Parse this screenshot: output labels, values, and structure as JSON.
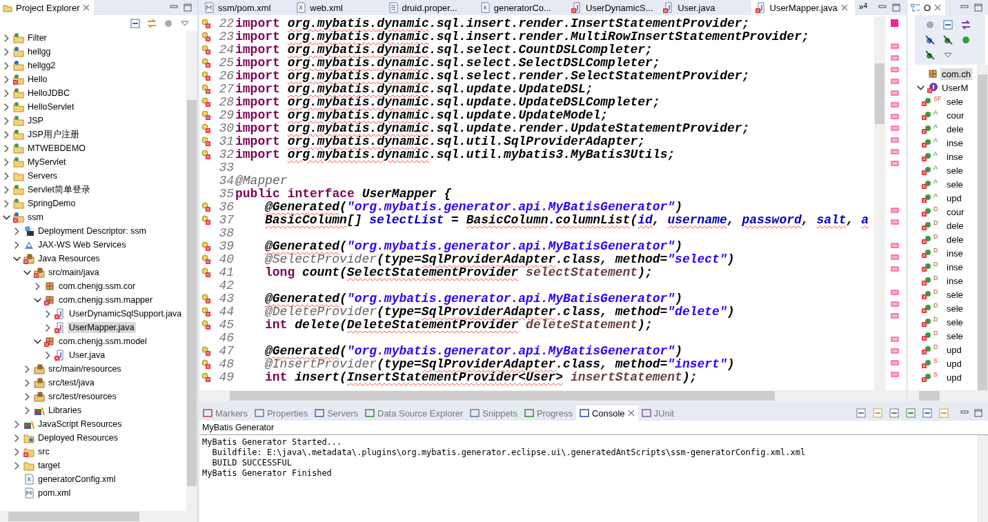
{
  "project_explorer": {
    "title": "Project Explorer",
    "tree": [
      {
        "label": "Filter",
        "kind": "project",
        "expanded": false,
        "selected": false,
        "error": false
      },
      {
        "label": "hellgg",
        "kind": "maven",
        "expanded": false,
        "selected": false,
        "error": false
      },
      {
        "label": "hellgg2",
        "kind": "maven",
        "expanded": false,
        "selected": false,
        "error": false
      },
      {
        "label": "Hello",
        "kind": "project",
        "expanded": false,
        "selected": false,
        "error": true
      },
      {
        "label": "HelloJDBC",
        "kind": "project",
        "expanded": false,
        "selected": false,
        "error": false
      },
      {
        "label": "HelloServlet",
        "kind": "project",
        "expanded": false,
        "selected": false,
        "error": false
      },
      {
        "label": "JSP",
        "kind": "project",
        "expanded": false,
        "selected": false,
        "error": false
      },
      {
        "label": "JSP用户注册",
        "kind": "project",
        "expanded": false,
        "selected": false,
        "error": false
      },
      {
        "label": "MTWEBDEMO",
        "kind": "project",
        "expanded": false,
        "selected": false,
        "error": false
      },
      {
        "label": "MyServlet",
        "kind": "project",
        "expanded": false,
        "selected": false,
        "error": false
      },
      {
        "label": "Servers",
        "kind": "folder",
        "expanded": false,
        "selected": false,
        "error": false
      },
      {
        "label": "Servlet简单登录",
        "kind": "project",
        "expanded": false,
        "selected": false,
        "error": false
      },
      {
        "label": "SpringDemo",
        "kind": "project",
        "expanded": false,
        "selected": false,
        "error": false
      },
      {
        "label": "ssm",
        "kind": "maven",
        "expanded": true,
        "selected": false,
        "error": true,
        "children": [
          {
            "label": "Deployment Descriptor: ssm",
            "kind": "descriptor",
            "expanded": false,
            "selected": false,
            "error": false
          },
          {
            "label": "JAX-WS Web Services",
            "kind": "webservice",
            "expanded": false,
            "selected": false,
            "error": false
          },
          {
            "label": "Java Resources",
            "kind": "resources",
            "expanded": true,
            "selected": false,
            "error": true,
            "children": [
              {
                "label": "src/main/java",
                "kind": "source",
                "expanded": true,
                "selected": false,
                "error": true,
                "children": [
                  {
                    "label": "com.chenjg.ssm.cor",
                    "kind": "package",
                    "expanded": false,
                    "selected": false,
                    "error": false
                  },
                  {
                    "label": "com.chenjg.ssm.mapper",
                    "kind": "package",
                    "expanded": true,
                    "selected": false,
                    "error": true,
                    "children": [
                      {
                        "label": "UserDynamicSqlSupport.java",
                        "kind": "java",
                        "expanded": false,
                        "selected": false,
                        "error": true
                      },
                      {
                        "label": "UserMapper.java",
                        "kind": "interface",
                        "expanded": false,
                        "selected": true,
                        "error": true
                      }
                    ]
                  },
                  {
                    "label": "com.chenjg.ssm.model",
                    "kind": "package",
                    "expanded": true,
                    "selected": false,
                    "error": true,
                    "children": [
                      {
                        "label": "User.java",
                        "kind": "java",
                        "expanded": false,
                        "selected": false,
                        "error": true
                      }
                    ]
                  }
                ]
              },
              {
                "label": "src/main/resources",
                "kind": "source",
                "expanded": false,
                "selected": false,
                "error": false
              },
              {
                "label": "src/test/java",
                "kind": "source",
                "expanded": false,
                "selected": false,
                "error": false
              },
              {
                "label": "src/test/resources",
                "kind": "source",
                "expanded": false,
                "selected": false,
                "error": false
              },
              {
                "label": "Libraries",
                "kind": "library",
                "expanded": false,
                "selected": false,
                "error": false
              }
            ]
          },
          {
            "label": "JavaScript Resources",
            "kind": "library",
            "expanded": false,
            "selected": false,
            "error": false
          },
          {
            "label": "Deployed Resources",
            "kind": "deployed",
            "expanded": false,
            "selected": false,
            "error": false
          },
          {
            "label": "src",
            "kind": "folder",
            "expanded": false,
            "selected": false,
            "error": true
          },
          {
            "label": "target",
            "kind": "folder",
            "expanded": false,
            "selected": false,
            "error": false
          },
          {
            "label": "generatorConfig.xml",
            "kind": "xml",
            "expanded": false,
            "selected": false,
            "error": false
          },
          {
            "label": "pom.xml",
            "kind": "pom",
            "expanded": false,
            "selected": false,
            "error": false
          }
        ]
      }
    ]
  },
  "editor": {
    "tabs": [
      {
        "label": "ssm/pom.xml",
        "kind": "pom",
        "selected": false,
        "error": false
      },
      {
        "label": "web.xml",
        "kind": "xml",
        "selected": false,
        "error": false
      },
      {
        "label": "druid.proper...",
        "kind": "text",
        "selected": false,
        "error": false
      },
      {
        "label": "generatorCo...",
        "kind": "xml",
        "selected": false,
        "error": false
      },
      {
        "label": "UserDynamicS...",
        "kind": "java",
        "selected": false,
        "error": true
      },
      {
        "label": "User.java",
        "kind": "java",
        "selected": false,
        "error": true
      },
      {
        "label": "UserMapper.java",
        "kind": "java",
        "selected": true,
        "error": true
      }
    ],
    "overflow": {
      "symbol": "»",
      "count": "4"
    },
    "lines": [
      {
        "number": "22",
        "marker": true,
        "indented": false,
        "segments": [
          {
            "t": "import ",
            "kind": "kw"
          },
          {
            "t": "org.mybatis.dynamic",
            "kind": "err"
          },
          {
            "t": ".sql.insert.render.InsertStatementProvider;",
            "kind": "bi"
          }
        ]
      },
      {
        "number": "23",
        "marker": true,
        "indented": false,
        "segments": [
          {
            "t": "import ",
            "kind": "kw"
          },
          {
            "t": "org.mybatis.dynamic",
            "kind": "err"
          },
          {
            "t": ".sql.insert.render.MultiRowInsertStatementProvider;",
            "kind": "bi"
          }
        ]
      },
      {
        "number": "24",
        "marker": true,
        "indented": false,
        "segments": [
          {
            "t": "import ",
            "kind": "kw"
          },
          {
            "t": "org.mybatis.dynamic",
            "kind": "err"
          },
          {
            "t": ".sql.select.CountDSLCompleter;",
            "kind": "bi"
          }
        ]
      },
      {
        "number": "25",
        "marker": true,
        "indented": false,
        "segments": [
          {
            "t": "import ",
            "kind": "kw"
          },
          {
            "t": "org.mybatis.dynamic",
            "kind": "err"
          },
          {
            "t": ".sql.select.SelectDSLCompleter;",
            "kind": "bi"
          }
        ]
      },
      {
        "number": "26",
        "marker": true,
        "indented": false,
        "segments": [
          {
            "t": "import ",
            "kind": "kw"
          },
          {
            "t": "org.mybatis.dynamic",
            "kind": "err"
          },
          {
            "t": ".sql.select.render.SelectStatementProvider;",
            "kind": "bi"
          }
        ]
      },
      {
        "number": "27",
        "marker": true,
        "indented": false,
        "segments": [
          {
            "t": "import ",
            "kind": "kw"
          },
          {
            "t": "org.mybatis.dynamic",
            "kind": "err"
          },
          {
            "t": ".sql.update.UpdateDSL;",
            "kind": "bi"
          }
        ]
      },
      {
        "number": "28",
        "marker": true,
        "indented": false,
        "segments": [
          {
            "t": "import ",
            "kind": "kw"
          },
          {
            "t": "org.mybatis.dynamic",
            "kind": "err"
          },
          {
            "t": ".sql.update.UpdateDSLCompleter;",
            "kind": "bi"
          }
        ]
      },
      {
        "number": "29",
        "marker": true,
        "indented": false,
        "segments": [
          {
            "t": "import ",
            "kind": "kw"
          },
          {
            "t": "org.mybatis.dynamic",
            "kind": "err"
          },
          {
            "t": ".sql.update.UpdateModel;",
            "kind": "bi"
          }
        ]
      },
      {
        "number": "30",
        "marker": true,
        "indented": false,
        "segments": [
          {
            "t": "import ",
            "kind": "kw"
          },
          {
            "t": "org.mybatis.dynamic",
            "kind": "err"
          },
          {
            "t": ".sql.update.render.UpdateStatementProvider;",
            "kind": "bi"
          }
        ]
      },
      {
        "number": "31",
        "marker": true,
        "indented": false,
        "segments": [
          {
            "t": "import ",
            "kind": "kw"
          },
          {
            "t": "org.mybatis.dynamic",
            "kind": "err"
          },
          {
            "t": ".sql.util.SqlProviderAdapter;",
            "kind": "bi"
          }
        ]
      },
      {
        "number": "32",
        "marker": true,
        "indented": false,
        "segments": [
          {
            "t": "import ",
            "kind": "kw"
          },
          {
            "t": "org.mybatis.dynamic",
            "kind": "err"
          },
          {
            "t": ".sql.util.mybatis3.MyBatis3Utils;",
            "kind": "bi"
          }
        ]
      },
      {
        "number": "33",
        "marker": false,
        "indented": false
      },
      {
        "number": "34",
        "marker": false,
        "indented": false,
        "segments": [
          {
            "t": "@Mapper",
            "kind": "ann"
          }
        ]
      },
      {
        "number": "35",
        "marker": false,
        "indented": false,
        "segments": [
          {
            "t": "public interface",
            "kind": "kw"
          },
          {
            "t": " UserMapper {",
            "kind": "bi"
          }
        ]
      },
      {
        "number": "36",
        "marker": true,
        "indented": true,
        "segments": [
          {
            "t": "@Generated",
            "kind": "err"
          },
          {
            "t": "(",
            "kind": "bi"
          },
          {
            "t": "\"org.mybatis.generator.api.MyBatisGenerator\"",
            "kind": "str"
          },
          {
            "t": ")",
            "kind": "bi"
          }
        ]
      },
      {
        "number": "37",
        "marker": true,
        "indented": true,
        "segments": [
          {
            "t": "BasicColumn",
            "kind": "err"
          },
          {
            "t": "[] ",
            "kind": "bi"
          },
          {
            "t": "selectList",
            "kind": "fld"
          },
          {
            "t": " = ",
            "kind": "bi"
          },
          {
            "t": "BasicColumn",
            "kind": "err"
          },
          {
            "t": ".",
            "kind": "bi"
          },
          {
            "t": "columnList",
            "kind": "err"
          },
          {
            "t": "(",
            "kind": "bi"
          },
          {
            "t": "id",
            "kind": "ferr"
          },
          {
            "t": ", ",
            "kind": "bi"
          },
          {
            "t": "username",
            "kind": "ferr"
          },
          {
            "t": ", ",
            "kind": "bi"
          },
          {
            "t": "password",
            "kind": "ferr"
          },
          {
            "t": ", ",
            "kind": "bi"
          },
          {
            "t": "salt",
            "kind": "ferr"
          },
          {
            "t": ", ",
            "kind": "bi"
          },
          {
            "t": "a",
            "kind": "ferr"
          }
        ]
      },
      {
        "number": "38",
        "marker": false,
        "indented": false
      },
      {
        "number": "39",
        "marker": true,
        "indented": true,
        "segments": [
          {
            "t": "@Generated",
            "kind": "err"
          },
          {
            "t": "(",
            "kind": "bi"
          },
          {
            "t": "\"org.mybatis.generator.api.MyBatisGenerator\"",
            "kind": "str"
          },
          {
            "t": ")",
            "kind": "bi"
          }
        ]
      },
      {
        "number": "40",
        "marker": true,
        "indented": true,
        "segments": [
          {
            "t": "@SelectProvider",
            "kind": "ann"
          },
          {
            "t": "(type=",
            "kind": "bi"
          },
          {
            "t": "SqlProviderAdapter",
            "kind": "err"
          },
          {
            "t": ".class, method=",
            "kind": "bi"
          },
          {
            "t": "\"select\"",
            "kind": "str"
          },
          {
            "t": ")",
            "kind": "bi"
          }
        ]
      },
      {
        "number": "41",
        "marker": true,
        "indented": true,
        "segments": [
          {
            "t": "long",
            "kind": "kw"
          },
          {
            "t": " count(",
            "kind": "bi"
          },
          {
            "t": "SelectStatementProvider",
            "kind": "err"
          },
          {
            "t": " selectStatement",
            "kind": "prm"
          },
          {
            "t": ");",
            "kind": "bi"
          }
        ]
      },
      {
        "number": "42",
        "marker": false,
        "indented": false
      },
      {
        "number": "43",
        "marker": true,
        "indented": true,
        "segments": [
          {
            "t": "@Generated",
            "kind": "err"
          },
          {
            "t": "(",
            "kind": "bi"
          },
          {
            "t": "\"org.mybatis.generator.api.MyBatisGenerator\"",
            "kind": "str"
          },
          {
            "t": ")",
            "kind": "bi"
          }
        ]
      },
      {
        "number": "44",
        "marker": true,
        "indented": true,
        "segments": [
          {
            "t": "@DeleteProvider",
            "kind": "ann"
          },
          {
            "t": "(type=",
            "kind": "bi"
          },
          {
            "t": "SqlProviderAdapter",
            "kind": "err"
          },
          {
            "t": ".class, method=",
            "kind": "bi"
          },
          {
            "t": "\"delete\"",
            "kind": "str"
          },
          {
            "t": ")",
            "kind": "bi"
          }
        ]
      },
      {
        "number": "45",
        "marker": true,
        "indented": true,
        "segments": [
          {
            "t": "int",
            "kind": "kw"
          },
          {
            "t": " delete(",
            "kind": "bi"
          },
          {
            "t": "DeleteStatementProvider",
            "kind": "err"
          },
          {
            "t": " deleteStatement",
            "kind": "prm"
          },
          {
            "t": ");",
            "kind": "bi"
          }
        ]
      },
      {
        "number": "46",
        "marker": false,
        "indented": false
      },
      {
        "number": "47",
        "marker": true,
        "indented": true,
        "segments": [
          {
            "t": "@Generated",
            "kind": "err"
          },
          {
            "t": "(",
            "kind": "bi"
          },
          {
            "t": "\"org.mybatis.generator.api.MyBatisGenerator\"",
            "kind": "str"
          },
          {
            "t": ")",
            "kind": "bi"
          }
        ]
      },
      {
        "number": "48",
        "marker": true,
        "indented": true,
        "segments": [
          {
            "t": "@InsertProvider",
            "kind": "ann"
          },
          {
            "t": "(type=",
            "kind": "bi"
          },
          {
            "t": "SqlProviderAdapter",
            "kind": "err"
          },
          {
            "t": ".class, method=",
            "kind": "bi"
          },
          {
            "t": "\"insert\"",
            "kind": "str"
          },
          {
            "t": ")",
            "kind": "bi"
          }
        ]
      },
      {
        "number": "49",
        "marker": true,
        "indented": true,
        "segments": [
          {
            "t": "int",
            "kind": "kw"
          },
          {
            "t": " insert(",
            "kind": "bi"
          },
          {
            "t": "InsertStatementProvider<User>",
            "kind": "err"
          },
          {
            "t": " insertStatement",
            "kind": "prm"
          },
          {
            "t": ");",
            "kind": "bi"
          }
        ]
      }
    ]
  },
  "outline": {
    "title": "O",
    "package": {
      "label": "com.ch",
      "selected": true
    },
    "type": {
      "label": "UserM",
      "expanded": true
    },
    "members": [
      {
        "flag": "SF",
        "label": "sele"
      },
      {
        "flag": "A",
        "label": "cour"
      },
      {
        "flag": "A",
        "label": "dele"
      },
      {
        "flag": "A",
        "label": "inse"
      },
      {
        "flag": "A",
        "label": "inse"
      },
      {
        "flag": "A",
        "label": "sele"
      },
      {
        "flag": "A",
        "label": "sele"
      },
      {
        "flag": "A",
        "label": "upd"
      },
      {
        "flag": "D",
        "label": "cour"
      },
      {
        "flag": "D",
        "label": "dele"
      },
      {
        "flag": "D",
        "label": "dele"
      },
      {
        "flag": "D",
        "label": "inse"
      },
      {
        "flag": "D",
        "label": "inse"
      },
      {
        "flag": "D",
        "label": "inse"
      },
      {
        "flag": "D",
        "label": "sele"
      },
      {
        "flag": "D",
        "label": "sele"
      },
      {
        "flag": "D",
        "label": "sele"
      },
      {
        "flag": "D",
        "label": "sele"
      },
      {
        "flag": "D",
        "label": "upd"
      },
      {
        "flag": "S",
        "label": "upd"
      },
      {
        "flag": "S",
        "label": "upd"
      }
    ]
  },
  "bottom": {
    "tabs": [
      {
        "label": "Markers",
        "selected": false
      },
      {
        "label": "Properties",
        "selected": false
      },
      {
        "label": "Servers",
        "selected": false
      },
      {
        "label": "Data Source Explorer",
        "selected": false
      },
      {
        "label": "Snippets",
        "selected": false
      },
      {
        "label": "Progress",
        "selected": false
      },
      {
        "label": "Console",
        "selected": true
      },
      {
        "label": "JUnit",
        "selected": false
      }
    ],
    "console_title": "MyBatis Generator",
    "console_lines": [
      "MyBatis Generator Started...",
      "  Buildfile: E:\\java\\.metadata\\.plugins\\org.mybatis.generator.eclipse.ui\\.generatedAntScripts\\ssm-generatorConfig.xml.xml",
      "  BUILD SUCCESSFUL",
      "MyBatis Generator Finished"
    ]
  }
}
